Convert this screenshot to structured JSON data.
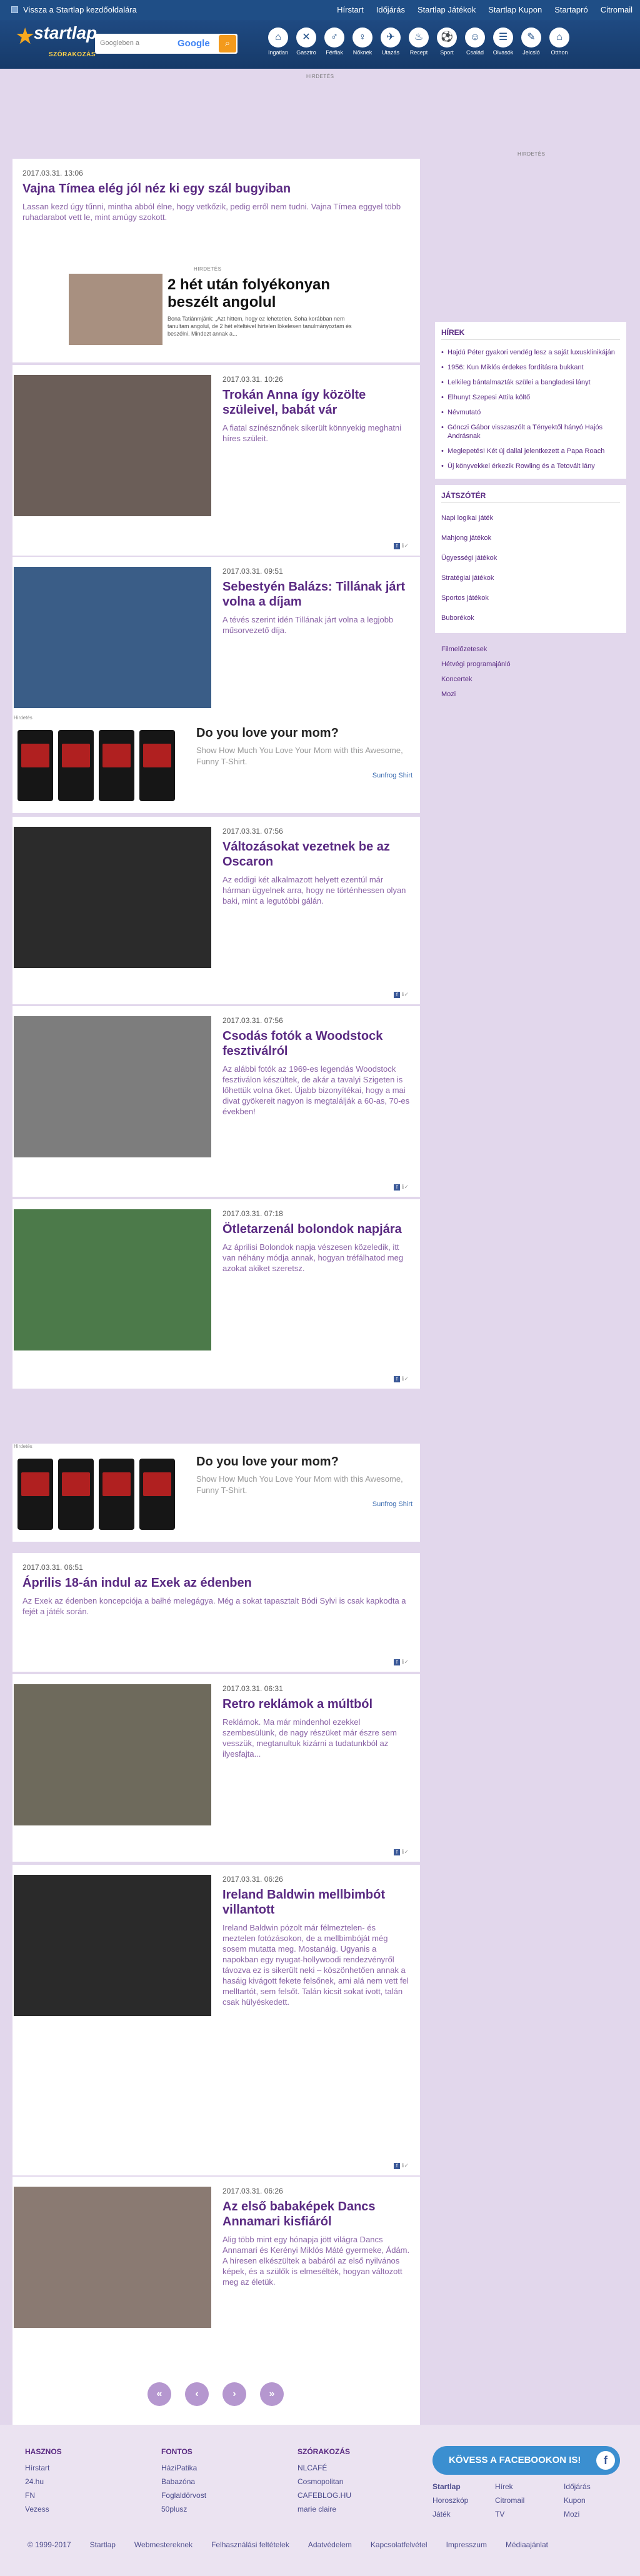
{
  "topbar": {
    "back_label": "Vissza a Startlap kezdőoldalára",
    "nav": [
      "Hírstart",
      "Időjárás",
      "Startlap Játékok",
      "Startlap Kupon",
      "Startapró",
      "Citromail"
    ]
  },
  "header": {
    "logo": "startlap",
    "logo_sub": "SZÓRAKOZÁS",
    "search_placeholder": "Googleben a",
    "search_brand": "Google",
    "categories": [
      {
        "label": "Ingatlan",
        "icon": "house-icon"
      },
      {
        "label": "Gasztro",
        "icon": "fork-icon"
      },
      {
        "label": "Férfiak",
        "icon": "man-icon"
      },
      {
        "label": "Nőknek",
        "icon": "woman-icon"
      },
      {
        "label": "Utazás",
        "icon": "plane-icon"
      },
      {
        "label": "Recept",
        "icon": "pot-icon"
      },
      {
        "label": "Sport",
        "icon": "ball-icon"
      },
      {
        "label": "Család",
        "icon": "family-icon"
      },
      {
        "label": "Olvasók",
        "icon": "book-icon"
      },
      {
        "label": "Jelcsló",
        "icon": "sign-icon"
      },
      {
        "label": "Otthon",
        "icon": "home-icon"
      }
    ]
  },
  "ad_label": "HIRDETÉS",
  "ad_label_2": "HIRDETÉS",
  "articles": [
    {
      "date": "2017.03.31. 13:06",
      "title": "Vajna Tímea elég jól néz ki egy szál bugyiban",
      "text": "Lassan kezd úgy tűnni, mintha abból élne, hogy vetkőzik, pedig erről nem tudni. Vajna Tímea eggyel több ruhadarabot vett le, mint amúgy szokott."
    },
    {
      "date": "2017.03.31. 10:26",
      "title": "Trokán Anna így közölte szüleivel, babát vár",
      "text": "A fiatal színésznőnek sikerült könnyekig meghatni híres szüleit."
    },
    {
      "date": "2017.03.31. 09:51",
      "title": "Sebestyén Balázs: Tillának járt volna a díjam",
      "text": "A tévés szerint idén Tillának járt volna a legjobb műsorvezető díja."
    },
    {
      "date": "2017.03.31. 07:56",
      "title": "Változásokat vezetnek be az Oscaron",
      "text": "Az eddigi két alkalmazott helyett ezentúl már hárman ügyelnek arra, hogy ne történhessen olyan baki, mint a legutóbbi gálán."
    },
    {
      "date": "2017.03.31. 07:56",
      "title": "Csodás fotók a Woodstock fesztiválról",
      "text": "Az alábbi fotók az 1969-es legendás Woodstock fesztiválon készültek, de akár a tavalyi Szigeten is lőhettük volna őket. Újabb bizonyítékai, hogy a mai divat gyökereit nagyon is megtalálják a 60-as, 70-es években!"
    },
    {
      "date": "2017.03.31. 07:18",
      "title": "Ötletarzenál bolondok napjára",
      "text": "Az áprilisi Bolondok napja vészesen közeledik, itt van néhány módja annak, hogyan tréfálhatod meg azokat akiket szeretsz."
    },
    {
      "date": "2017.03.31. 06:51",
      "title": "Április 18-án indul az Exek az édenben",
      "text": "Az Exek az édenben koncepciója a bałhé melegágya. Még a sokat tapasztalt Bódi Sylvi is csak kapkodta a fejét a játék során."
    },
    {
      "date": "2017.03.31. 06:31",
      "title": "Retro reklámok a múltból",
      "text": "Reklámok. Ma már mindenhol ezekkel szembesülünk, de nagy részüket már észre sem vesszük, megtanultuk kizárni a tudatunkból az ilyesfajta..."
    },
    {
      "date": "2017.03.31. 06:26",
      "title": "Ireland Baldwin mellbimbót villantott",
      "text": "Ireland Baldwin pózolt már félmeztelen- és meztelen fotózásokon, de a mellbimbóját még sosem mutatta meg. Mostanáig. Ugyanis a napokban egy nyugat-hollywoodi rendezvényről távozva ez is sikerült neki – köszönhetően annak a hasáig kivágott fekete felsőnek, ami alá nem vett fel melltartót, sem felsőt. Talán kicsit sokat ivott, talán csak hülyéskedett."
    },
    {
      "date": "2017.03.31. 06:26",
      "title": "Az első babaképek Dancs Annamari kisfiáról",
      "text": "Alig több mint egy hónapja jött világra Dancs Annamari és Kerényi Miklós Máté gyermeke, Ádám. A híresen elkészültek a babáról az első nyilvános képek, és a szülők is elmesélték, hogyan változott meg az életük."
    }
  ],
  "inline_ad": {
    "label": "HIRDETÉS",
    "title": "2 hét után folyékonyan beszélt angolul",
    "text": "Bona Tatiánmjánk: „Azt hittem, hogy ez lehetetlen. Soha korábban nem tanultam angolul, de 2 hét elteltével hirtelen lökelesen tanulmányoztam és beszélni. Mindezt annak a..."
  },
  "shirt_ad": {
    "label": "Hirdetés",
    "headline": "Do you love your mom?",
    "body": "Show How Much You Love Your Mom with this Awesome, Funny T-Shirt.",
    "link": "Sunfrog Shirt",
    "shirt_text": [
      "PROUD SON",
      "SON MOM",
      "PROUD MOM",
      "SON MOM"
    ]
  },
  "sidebar": {
    "news_title": "HÍREK",
    "news": [
      "Hajdú Péter gyakori vendég lesz a saját luxusklinikáján",
      "1956: Kun Miklós érdekes fordításra bukkant",
      "Lelkileg bántalmazták szülei a bangladesi lányt",
      "Elhunyt Szepesi Attila költő",
      "Névmutató",
      "Gönczi Gábor visszaszólt a Tényektől hányó Hajós Andrásnak",
      "Meglepetés! Két új dallal jelentkezett a Papa Roach",
      "Új könyvekkel érkezik Rowling és a Tetovált lány"
    ],
    "games_title": "JÁTSZÓTÉR",
    "games": [
      "Napi logikai játék",
      "Mahjong játékok",
      "Ügyességi játékok",
      "Stratégiai játékok",
      "Sportos játékok",
      "Buborékok"
    ],
    "extra": [
      "Filmelőzetesek",
      "Hétvégi programajánló",
      "Koncertek",
      "Mozi"
    ]
  },
  "pager": [
    "«",
    "‹",
    "›",
    "»"
  ],
  "footer": {
    "cols": [
      {
        "title": "HASZNOS",
        "items": [
          "Hírstart",
          "24.hu",
          "FN",
          "Vezess"
        ]
      },
      {
        "title": "FONTOS",
        "items": [
          "HáziPatika",
          "Babazóna",
          "Foglaldörvost",
          "50plusz"
        ]
      },
      {
        "title": "SZÓRAKOZÁS",
        "items": [
          "NLCAFÉ",
          "Cosmopolitan",
          "CAFEBLOG.HU",
          "marie claire"
        ]
      }
    ],
    "fb_label": "KÖVESS A FACEBOOKON IS!",
    "links": [
      "Startlap",
      "Hírek",
      "Időjárás",
      "Horoszkóp",
      "Citromail",
      "Kupon",
      "Játék",
      "TV",
      "Mozi"
    ],
    "bottom": [
      "© 1999-2017",
      "Startlap",
      "Webmestereknek",
      "Felhasználási feltételek",
      "Adatvédelem",
      "Kapcsolatfelvétel",
      "Impresszum",
      "Médiaajánlat"
    ]
  }
}
